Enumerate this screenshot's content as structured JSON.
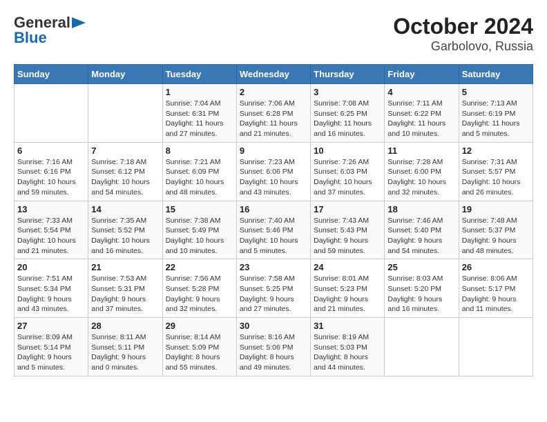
{
  "logo": {
    "text1": "General",
    "text2": "Blue"
  },
  "title": "October 2024",
  "subtitle": "Garbolovo, Russia",
  "days_of_week": [
    "Sunday",
    "Monday",
    "Tuesday",
    "Wednesday",
    "Thursday",
    "Friday",
    "Saturday"
  ],
  "weeks": [
    [
      {
        "day": "",
        "detail": ""
      },
      {
        "day": "",
        "detail": ""
      },
      {
        "day": "1",
        "detail": "Sunrise: 7:04 AM\nSunset: 6:31 PM\nDaylight: 11 hours\nand 27 minutes."
      },
      {
        "day": "2",
        "detail": "Sunrise: 7:06 AM\nSunset: 6:28 PM\nDaylight: 11 hours\nand 21 minutes."
      },
      {
        "day": "3",
        "detail": "Sunrise: 7:08 AM\nSunset: 6:25 PM\nDaylight: 11 hours\nand 16 minutes."
      },
      {
        "day": "4",
        "detail": "Sunrise: 7:11 AM\nSunset: 6:22 PM\nDaylight: 11 hours\nand 10 minutes."
      },
      {
        "day": "5",
        "detail": "Sunrise: 7:13 AM\nSunset: 6:19 PM\nDaylight: 11 hours\nand 5 minutes."
      }
    ],
    [
      {
        "day": "6",
        "detail": "Sunrise: 7:16 AM\nSunset: 6:16 PM\nDaylight: 10 hours\nand 59 minutes."
      },
      {
        "day": "7",
        "detail": "Sunrise: 7:18 AM\nSunset: 6:12 PM\nDaylight: 10 hours\nand 54 minutes."
      },
      {
        "day": "8",
        "detail": "Sunrise: 7:21 AM\nSunset: 6:09 PM\nDaylight: 10 hours\nand 48 minutes."
      },
      {
        "day": "9",
        "detail": "Sunrise: 7:23 AM\nSunset: 6:06 PM\nDaylight: 10 hours\nand 43 minutes."
      },
      {
        "day": "10",
        "detail": "Sunrise: 7:26 AM\nSunset: 6:03 PM\nDaylight: 10 hours\nand 37 minutes."
      },
      {
        "day": "11",
        "detail": "Sunrise: 7:28 AM\nSunset: 6:00 PM\nDaylight: 10 hours\nand 32 minutes."
      },
      {
        "day": "12",
        "detail": "Sunrise: 7:31 AM\nSunset: 5:57 PM\nDaylight: 10 hours\nand 26 minutes."
      }
    ],
    [
      {
        "day": "13",
        "detail": "Sunrise: 7:33 AM\nSunset: 5:54 PM\nDaylight: 10 hours\nand 21 minutes."
      },
      {
        "day": "14",
        "detail": "Sunrise: 7:35 AM\nSunset: 5:52 PM\nDaylight: 10 hours\nand 16 minutes."
      },
      {
        "day": "15",
        "detail": "Sunrise: 7:38 AM\nSunset: 5:49 PM\nDaylight: 10 hours\nand 10 minutes."
      },
      {
        "day": "16",
        "detail": "Sunrise: 7:40 AM\nSunset: 5:46 PM\nDaylight: 10 hours\nand 5 minutes."
      },
      {
        "day": "17",
        "detail": "Sunrise: 7:43 AM\nSunset: 5:43 PM\nDaylight: 9 hours\nand 59 minutes."
      },
      {
        "day": "18",
        "detail": "Sunrise: 7:46 AM\nSunset: 5:40 PM\nDaylight: 9 hours\nand 54 minutes."
      },
      {
        "day": "19",
        "detail": "Sunrise: 7:48 AM\nSunset: 5:37 PM\nDaylight: 9 hours\nand 48 minutes."
      }
    ],
    [
      {
        "day": "20",
        "detail": "Sunrise: 7:51 AM\nSunset: 5:34 PM\nDaylight: 9 hours\nand 43 minutes."
      },
      {
        "day": "21",
        "detail": "Sunrise: 7:53 AM\nSunset: 5:31 PM\nDaylight: 9 hours\nand 37 minutes."
      },
      {
        "day": "22",
        "detail": "Sunrise: 7:56 AM\nSunset: 5:28 PM\nDaylight: 9 hours\nand 32 minutes."
      },
      {
        "day": "23",
        "detail": "Sunrise: 7:58 AM\nSunset: 5:25 PM\nDaylight: 9 hours\nand 27 minutes."
      },
      {
        "day": "24",
        "detail": "Sunrise: 8:01 AM\nSunset: 5:23 PM\nDaylight: 9 hours\nand 21 minutes."
      },
      {
        "day": "25",
        "detail": "Sunrise: 8:03 AM\nSunset: 5:20 PM\nDaylight: 9 hours\nand 16 minutes."
      },
      {
        "day": "26",
        "detail": "Sunrise: 8:06 AM\nSunset: 5:17 PM\nDaylight: 9 hours\nand 11 minutes."
      }
    ],
    [
      {
        "day": "27",
        "detail": "Sunrise: 8:09 AM\nSunset: 5:14 PM\nDaylight: 9 hours\nand 5 minutes."
      },
      {
        "day": "28",
        "detail": "Sunrise: 8:11 AM\nSunset: 5:11 PM\nDaylight: 9 hours\nand 0 minutes."
      },
      {
        "day": "29",
        "detail": "Sunrise: 8:14 AM\nSunset: 5:09 PM\nDaylight: 8 hours\nand 55 minutes."
      },
      {
        "day": "30",
        "detail": "Sunrise: 8:16 AM\nSunset: 5:06 PM\nDaylight: 8 hours\nand 49 minutes."
      },
      {
        "day": "31",
        "detail": "Sunrise: 8:19 AM\nSunset: 5:03 PM\nDaylight: 8 hours\nand 44 minutes."
      },
      {
        "day": "",
        "detail": ""
      },
      {
        "day": "",
        "detail": ""
      }
    ]
  ]
}
